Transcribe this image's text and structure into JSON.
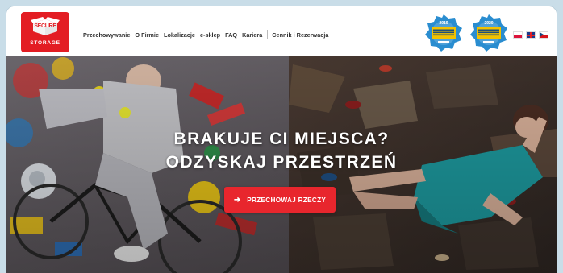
{
  "brand": {
    "logo_text": "SECURE",
    "logo_subtext": "STORAGE",
    "color": "#e31d23"
  },
  "nav": {
    "items": [
      {
        "label": "Przechowywanie"
      },
      {
        "label": "O Firmie"
      },
      {
        "label": "Lokalizacje"
      },
      {
        "label": "e-sklep"
      },
      {
        "label": "FAQ"
      },
      {
        "label": "Kariera"
      },
      {
        "label": "Cennik i Rezerwacja"
      }
    ]
  },
  "badges": {
    "badge1_year": "2019",
    "badge2_year": "2020",
    "color": "#2a8dd0"
  },
  "languages": [
    "pl",
    "en",
    "cz"
  ],
  "hero": {
    "title_line1": "BRAKUJE CI MIEJSCA?",
    "title_line2": "ODZYSKAJ PRZESTRZEŃ",
    "cta_label": "PRZECHOWAJ RZECZY",
    "cta_icon": "arrow-right-icon",
    "cta_color": "#e8262d"
  }
}
